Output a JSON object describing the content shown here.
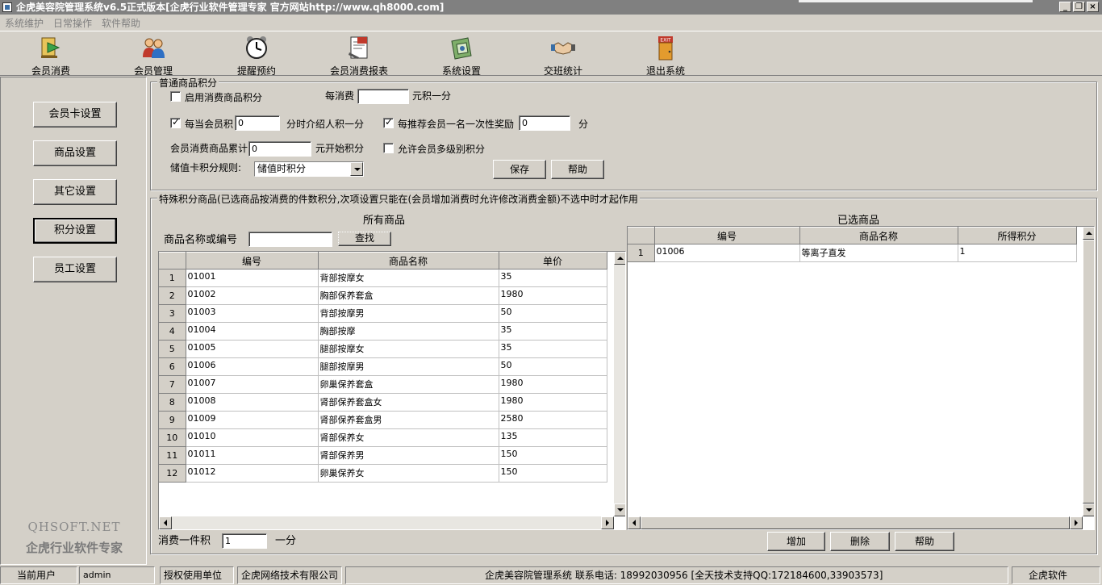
{
  "window": {
    "title": "企虎美容院管理系统v6.5正式版本[企虎行业软件管理专家 官方网站http://www.qh8000.com]",
    "btn_min": "_",
    "btn_restore": "❐",
    "btn_close": "×"
  },
  "menu": [
    "系统维护",
    "日常操作",
    "软件帮助"
  ],
  "toolbar": [
    {
      "label": "会员消费",
      "icon": "member-consume-icon"
    },
    {
      "label": "会员管理",
      "icon": "member-manage-icon"
    },
    {
      "label": "提醒预约",
      "icon": "alarm-clock-icon"
    },
    {
      "label": "会员消费报表",
      "icon": "report-icon"
    },
    {
      "label": "系统设置",
      "icon": "settings-icon"
    },
    {
      "label": "交班统计",
      "icon": "handshake-icon"
    },
    {
      "label": "退出系统",
      "icon": "exit-door-icon"
    }
  ],
  "exit_sign": "EXIT",
  "sidebar": {
    "items": [
      "会员卡设置",
      "商品设置",
      "其它设置",
      "积分设置",
      "员工设置"
    ],
    "active_index": 3,
    "brand_line1": "QHSOFT.NET",
    "brand_line2": "企虎行业软件专家"
  },
  "normal_points": {
    "group_title": "普通商品积分",
    "enable_label": "启用消费商品积分",
    "enable_checked": false,
    "per_consume_label": "每消费",
    "per_consume_value": "",
    "per_consume_suffix": "元积一分",
    "member_points_label": "每当会员积",
    "member_points_checked": true,
    "member_points_value": "0",
    "member_points_suffix": "分时介绍人积一分",
    "referral_label": "每推荐会员一名一次性奖励",
    "referral_checked": true,
    "referral_value": "0",
    "referral_suffix": "分",
    "cumulative_label": "会员消费商品累计",
    "cumulative_value": "0",
    "cumulative_suffix": "元开始积分",
    "multilevel_label": "允许会员多级别积分",
    "multilevel_checked": false,
    "stored_rule_label": "储值卡积分规则:",
    "stored_rule_value": "储值时积分",
    "save_button": "保存",
    "help_button": "帮助"
  },
  "special_points": {
    "group_title": "特殊积分商品(已选商品按消费的件数积分,次项设置只能在(会员增加消费时允许修改消费金额)不选中时才起作用",
    "all_goods_title": "所有商品",
    "search_label": "商品名称或编号",
    "search_value": "",
    "search_button": "查找",
    "all_columns": [
      "编号",
      "商品名称",
      "单价"
    ],
    "all_rows": [
      [
        "1",
        "01001",
        "背部按摩女",
        "35"
      ],
      [
        "2",
        "01002",
        "胸部保养套盒",
        "1980"
      ],
      [
        "3",
        "01003",
        "背部按摩男",
        "50"
      ],
      [
        "4",
        "01004",
        "胸部按摩",
        "35"
      ],
      [
        "5",
        "01005",
        "腿部按摩女",
        "35"
      ],
      [
        "6",
        "01006",
        "腿部按摩男",
        "50"
      ],
      [
        "7",
        "01007",
        "卵巢保养套盒",
        "1980"
      ],
      [
        "8",
        "01008",
        "肾部保养套盒女",
        "1980"
      ],
      [
        "9",
        "01009",
        "肾部保养套盒男",
        "2580"
      ],
      [
        "10",
        "01010",
        "肾部保养女",
        "135"
      ],
      [
        "11",
        "01011",
        "肾部保养男",
        "150"
      ],
      [
        "12",
        "01012",
        "卵巢保养女",
        "150"
      ]
    ],
    "selected_title": "已选商品",
    "selected_columns": [
      "编号",
      "商品名称",
      "所得积分"
    ],
    "selected_rows": [
      [
        "1",
        "01006",
        "等离子直发",
        "1"
      ]
    ],
    "per_item_label": "消费一件积",
    "per_item_value": "1",
    "per_item_suffix": "一分",
    "add_button": "增加",
    "delete_button": "删除",
    "help_button": "帮助"
  },
  "status": {
    "current_user_label": "当前用户",
    "current_user": "admin",
    "license_label": "授权使用单位",
    "license_unit": "企虎网络技术有限公司",
    "info": "企虎美容院管理系统    联系电话: 18992030956  [全天技术支持QQ:172184600,33903573]",
    "vendor": "企虎软件"
  },
  "colors": {
    "face": "#d4d0c8",
    "title_inactive": "#808080"
  }
}
